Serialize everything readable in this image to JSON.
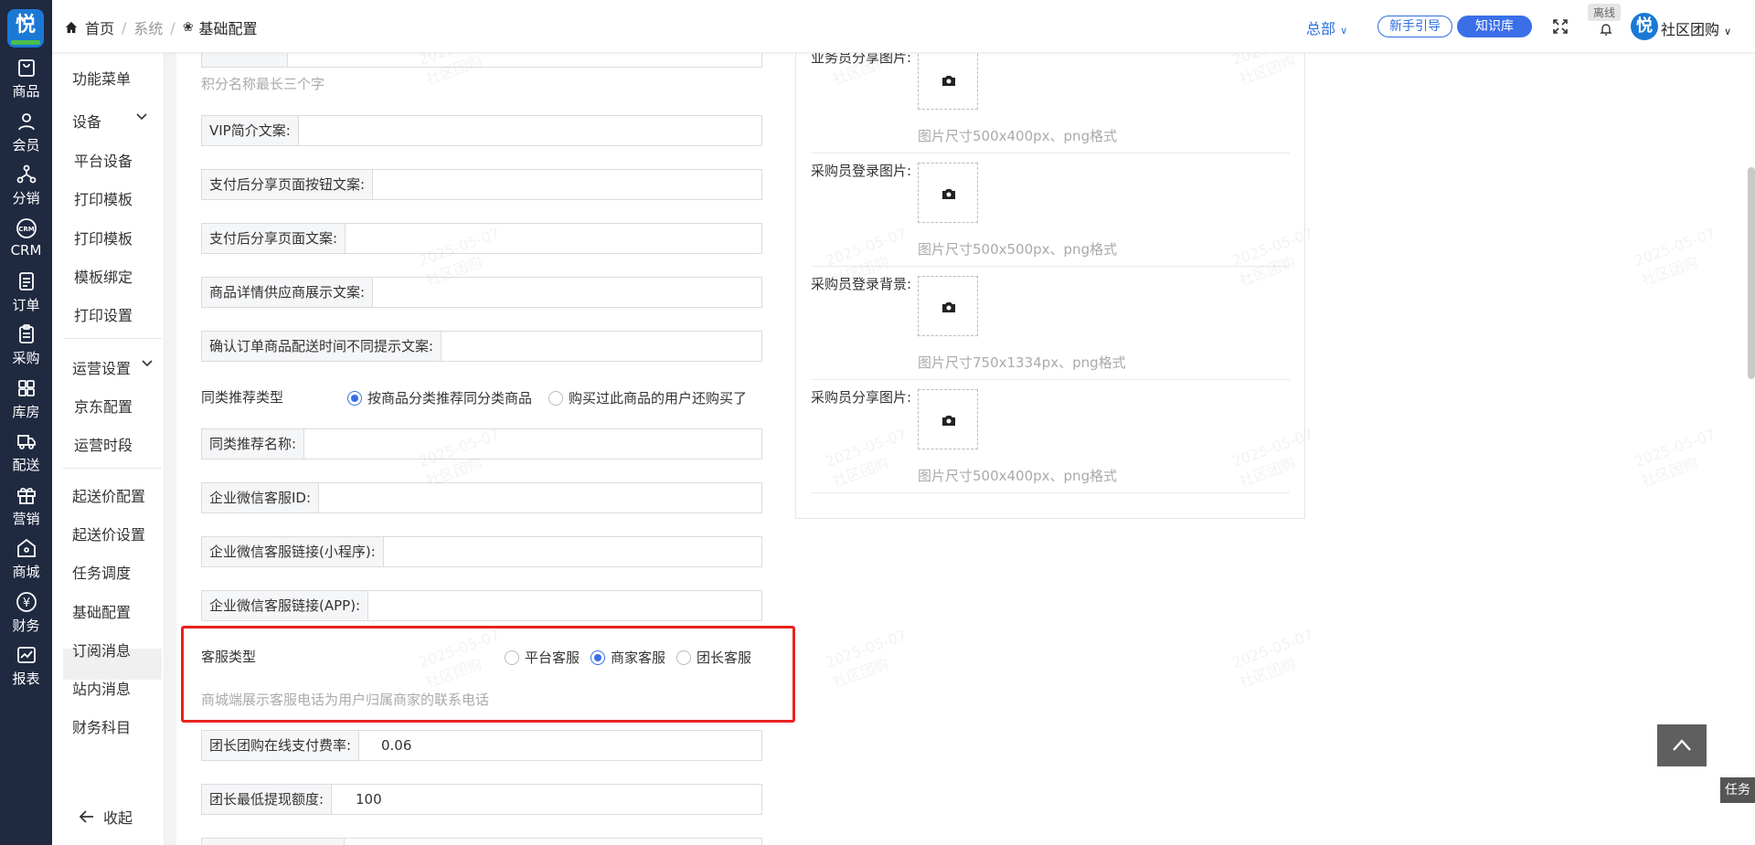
{
  "rail": {
    "logo": "悦",
    "items": [
      {
        "label": "商品",
        "icon": "bag-icon"
      },
      {
        "label": "会员",
        "icon": "user-icon"
      },
      {
        "label": "分销",
        "icon": "share-network-icon"
      },
      {
        "label": "CRM",
        "icon": "crm-icon"
      },
      {
        "label": "订单",
        "icon": "document-icon"
      },
      {
        "label": "采购",
        "icon": "clipboard-icon"
      },
      {
        "label": "库房",
        "icon": "grid-icon"
      },
      {
        "label": "配送",
        "icon": "truck-icon"
      },
      {
        "label": "营销",
        "icon": "gift-icon"
      },
      {
        "label": "商城",
        "icon": "store-icon"
      },
      {
        "label": "财务",
        "icon": "yen-icon"
      },
      {
        "label": "报表",
        "icon": "chart-icon"
      }
    ]
  },
  "topbar": {
    "home": "首页",
    "system": "系统",
    "current": "基础配置",
    "hq": "总部",
    "guide": "新手引导",
    "kb": "知识库",
    "offline": "离线",
    "avatar": "悦",
    "user": "社区团购"
  },
  "subnav": {
    "function_menu": "功能菜单",
    "device_group": "设备",
    "device_items": [
      "平台设备",
      "打印模板",
      "打印模板",
      "模板绑定",
      "打印设置"
    ],
    "ops_group": "运营设置",
    "ops_items": [
      "京东配置",
      "运营时段"
    ],
    "items": [
      "起送价配置",
      "起送价设置",
      "任务调度",
      "基础配置",
      "订阅消息",
      "站内消息",
      "财务科目"
    ],
    "collapse": "收起"
  },
  "form": {
    "points_hint": "积分名称最长三个字",
    "vip_label": "VIP简介文案:",
    "pay_btn_label": "支付后分享页面按钮文案:",
    "pay_page_label": "支付后分享页面文案:",
    "supplier_label": "商品详情供应商展示文案:",
    "confirm_label": "确认订单商品配送时间不同提示文案:",
    "similar_type_label": "同类推荐类型",
    "similar_opt1": "按商品分类推荐同分类商品",
    "similar_opt2": "购买过此商品的用户还购买了",
    "similar_name_label": "同类推荐名称:",
    "wecom_id_label": "企业微信客服ID:",
    "wecom_mini_label": "企业微信客服链接(小程序):",
    "wecom_app_label": "企业微信客服链接(APP):",
    "cs_type_label": "客服类型",
    "cs_opt1": "平台客服",
    "cs_opt2": "商家客服",
    "cs_opt3": "团长客服",
    "cs_hint": "商城端展示客服电话为用户归属商家的联系电话",
    "fee_label": "团长团购在线支付费率:",
    "fee_value": "0.06",
    "min_withdraw_label": "团长最低提现额度:",
    "min_withdraw_value": "100"
  },
  "images": {
    "top_label": "业务员分享图片:",
    "top_hint": "图片尺寸500x400px、png格式",
    "login_label": "采购员登录图片:",
    "login_hint": "图片尺寸500x500px、png格式",
    "bg_label": "采购员登录背景:",
    "bg_hint": "图片尺寸750x1334px、png格式",
    "share_label": "采购员分享图片:",
    "share_hint": "图片尺寸500x400px、png格式"
  },
  "task": "任务",
  "watermark": {
    "date": "2025-05-07",
    "name": "社区团购"
  },
  "colors": {
    "rail": "#1f2940",
    "accent": "#3a6fe8",
    "highlight": "#e8231f"
  }
}
